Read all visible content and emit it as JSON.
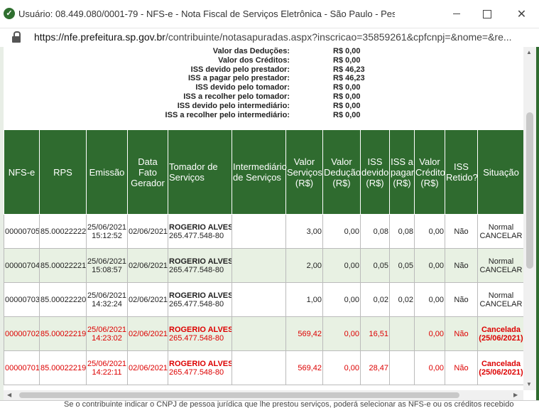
{
  "window": {
    "title": "Usuário: 08.449.080/0001-79 - NFS-e - Nota Fiscal de Serviços Eletrônica - São Paulo - Pessoal — Microsoft Ed...",
    "url_domain": "https://nfe.prefeitura.sp.gov.br",
    "url_path": "/contribuinte/notasapuradas.aspx?inscricao=35859261&cpfcnpj=&nome=&re..."
  },
  "summary": [
    {
      "label": "Valor das Deduções:",
      "value": "R$ 0,00"
    },
    {
      "label": "Valor dos Créditos:",
      "value": "R$ 0,00"
    },
    {
      "label": "ISS devido pelo prestador:",
      "value": "R$ 46,23"
    },
    {
      "label": "ISS a pagar pelo prestador:",
      "value": "R$ 46,23"
    },
    {
      "label": "ISS devido pelo tomador:",
      "value": "R$ 0,00"
    },
    {
      "label": "ISS a recolher pelo tomador:",
      "value": "R$ 0,00"
    },
    {
      "label": "ISS devido pelo intermediário:",
      "value": "R$ 0,00"
    },
    {
      "label": "ISS a recolher pelo intermediário:",
      "value": "R$ 0,00"
    }
  ],
  "table": {
    "headers": [
      "NFS-e",
      "RPS",
      "Emissão",
      "Data Fato Gerador",
      "Tomador de Serviços",
      "Intermediário de Serviços",
      "Valor Serviços (R$)",
      "Valor Dedução (R$)",
      "ISS devido (R$)",
      "ISS a pagar (R$)",
      "Valor Crédito (R$)",
      "ISS Retido?",
      "Situação"
    ],
    "rows": [
      {
        "nfse": "00000705",
        "rps": "85.00022222",
        "emissao_date": "25/06/2021",
        "emissao_time": "15:12:52",
        "fato": "02/06/2021",
        "tomador_name": "ROGERIO ALVES DE OLIVEIRA",
        "tomador_doc": "265.477.548-80",
        "intermediario": "",
        "valor": "3,00",
        "deducao": "0,00",
        "iss_devido": "0,08",
        "iss_pagar": "0,08",
        "credito": "0,00",
        "retido": "Não",
        "situacao": "Normal",
        "acao": "CANCELAR"
      },
      {
        "nfse": "00000704",
        "rps": "85.00022221",
        "emissao_date": "25/06/2021",
        "emissao_time": "15:08:57",
        "fato": "02/06/2021",
        "tomador_name": "ROGERIO ALVES DE OLIVEIRA",
        "tomador_doc": "265.477.548-80",
        "intermediario": "",
        "valor": "2,00",
        "deducao": "0,00",
        "iss_devido": "0,05",
        "iss_pagar": "0,05",
        "credito": "0,00",
        "retido": "Não",
        "situacao": "Normal",
        "acao": "CANCELAR"
      },
      {
        "nfse": "00000703",
        "rps": "85.00022220",
        "emissao_date": "25/06/2021",
        "emissao_time": "14:32:24",
        "fato": "02/06/2021",
        "tomador_name": "ROGERIO ALVES DE OLIVEIRA",
        "tomador_doc": "265.477.548-80",
        "intermediario": "",
        "valor": "1,00",
        "deducao": "0,00",
        "iss_devido": "0,02",
        "iss_pagar": "0,02",
        "credito": "0,00",
        "retido": "Não",
        "situacao": "Normal",
        "acao": "CANCELAR"
      },
      {
        "nfse": "00000702",
        "rps": "85.00022219",
        "emissao_date": "25/06/2021",
        "emissao_time": "14:23:02",
        "fato": "02/06/2021",
        "tomador_name": "ROGERIO ALVES DE OLIVEIRA",
        "tomador_doc": "265.477.548-80",
        "intermediario": "",
        "valor": "569,42",
        "deducao": "0,00",
        "iss_devido": "16,51",
        "iss_pagar": "",
        "credito": "0,00",
        "retido": "Não",
        "situacao": "Cancelada",
        "acao": "(25/06/2021)"
      },
      {
        "nfse": "00000701",
        "rps": "85.00022219",
        "emissao_date": "25/06/2021",
        "emissao_time": "14:22:11",
        "fato": "02/06/2021",
        "tomador_name": "ROGERIO ALVES DE OLIVEIRA",
        "tomador_doc": "265.477.548-80",
        "intermediario": "",
        "valor": "569,42",
        "deducao": "0,00",
        "iss_devido": "28,47",
        "iss_pagar": "",
        "credito": "0,00",
        "retido": "Não",
        "situacao": "Cancelada",
        "acao": "(25/06/2021)"
      }
    ]
  },
  "background_text": "Se o contribuinte indicar o CNPJ de pessoa jurídica que lhe prestou serviços, poderá selecionar as NFS-e ou os créditos recebido",
  "colors": {
    "header_green": "#2f6b2f",
    "alt_row": "#e8f1e3",
    "cancel_red": "#d00000"
  }
}
